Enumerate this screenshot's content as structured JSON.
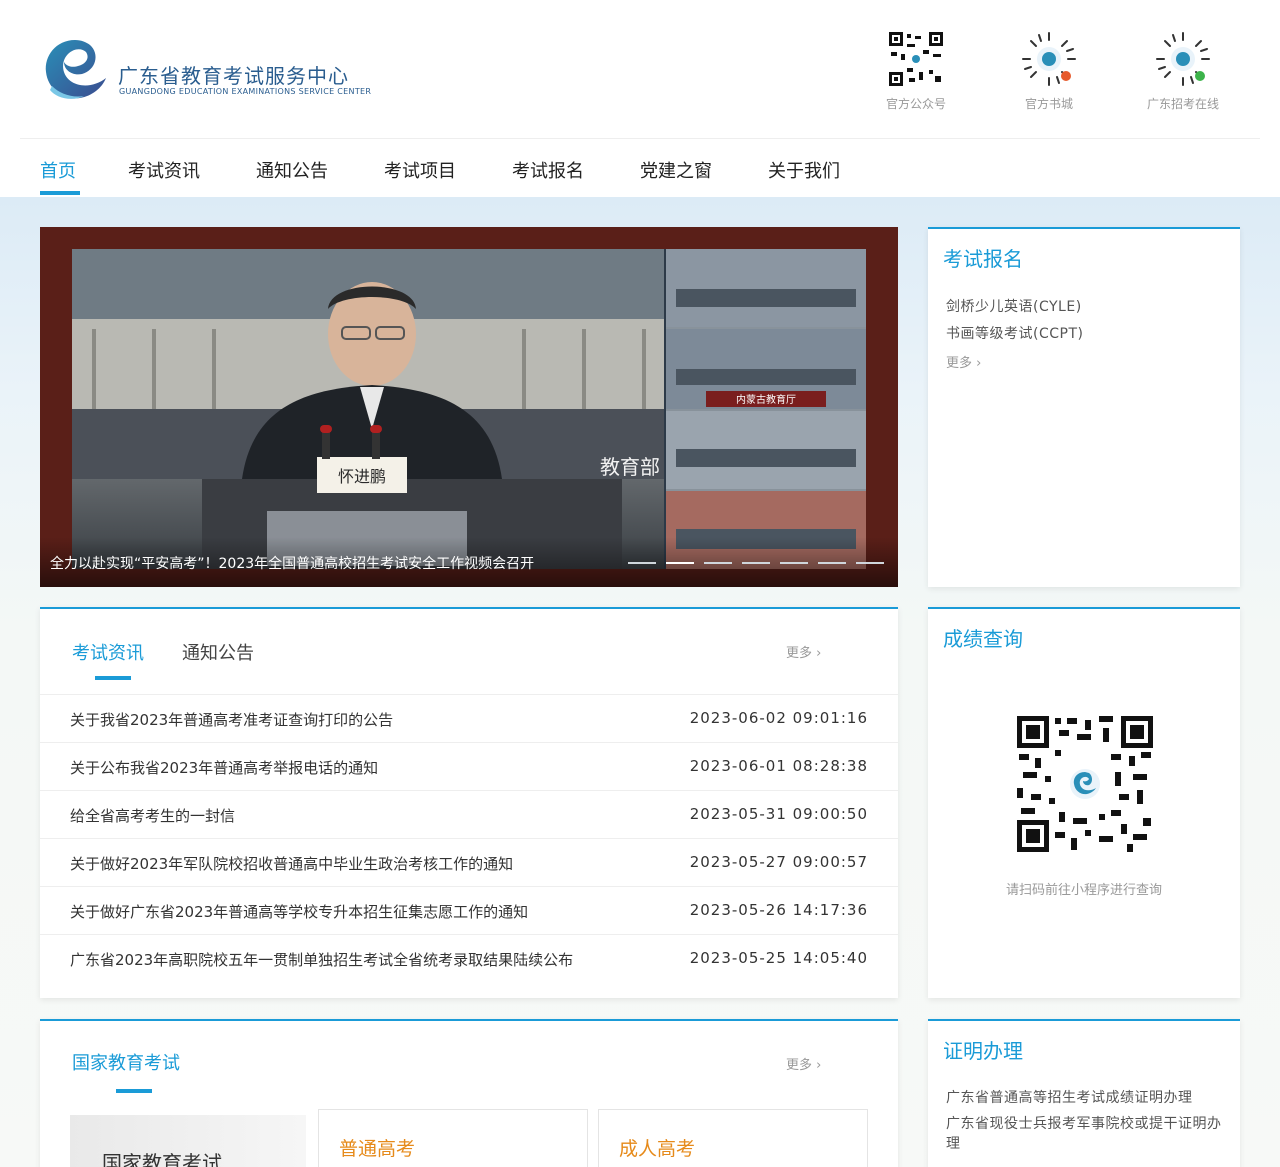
{
  "header": {
    "org_name_cn": "广东省教育考试服务中心",
    "org_name_en": "GUANGDONG EDUCATION EXAMINATIONS SERVICE CENTER",
    "qr_codes": [
      {
        "label": "官方公众号"
      },
      {
        "label": "官方书城"
      },
      {
        "label": "广东招考在线"
      }
    ]
  },
  "nav": {
    "items": [
      "首页",
      "考试资讯",
      "通知公告",
      "考试项目",
      "考试报名",
      "党建之窗",
      "关于我们"
    ],
    "active_index": 0
  },
  "banner": {
    "caption": "全力以赴实现“平安高考”！2023年全国普通高校招生考试安全工作视频会召开",
    "slide_count": 7,
    "active_slide": 1,
    "image_text": {
      "name_card": "怀进鹏",
      "wall_text": "教育部",
      "panel_label": "内蒙古教育厅"
    }
  },
  "exam_registration": {
    "title": "考试报名",
    "items": [
      "剑桥少儿英语(CYLE)",
      "书画等级考试(CCPT)"
    ],
    "more": "更多"
  },
  "news": {
    "tabs": [
      "考试资讯",
      "通知公告"
    ],
    "active_tab": 0,
    "more": "更多",
    "items": [
      {
        "title": "关于我省2023年普通高考准考证查询打印的公告",
        "date": "2023-06-02 09:01:16"
      },
      {
        "title": "关于公布我省2023年普通高考举报电话的通知",
        "date": "2023-06-01 08:28:38"
      },
      {
        "title": "给全省高考考生的一封信",
        "date": "2023-05-31 09:00:50"
      },
      {
        "title": "关于做好2023年军队院校招收普通高中毕业生政治考核工作的通知",
        "date": "2023-05-27 09:00:57"
      },
      {
        "title": "关于做好广东省2023年普通高等学校专升本招生征集志愿工作的通知",
        "date": "2023-05-26 14:17:36"
      },
      {
        "title": "广东省2023年高职院校五年一贯制单独招生考试全省统考录取结果陆续公布",
        "date": "2023-05-25 14:05:40"
      }
    ]
  },
  "score_query": {
    "title": "成绩查询",
    "hint": "请扫码前往小程序进行查询"
  },
  "national_exams": {
    "title": "国家教育考试",
    "more": "更多",
    "image_label": "国家教育考试",
    "cards": [
      "普通高考",
      "成人高考"
    ]
  },
  "certificate": {
    "title": "证明办理",
    "items": [
      "广东省普通高等招生考试成绩证明办理",
      "广东省现役士兵报考军事院校或提干证明办理"
    ]
  },
  "colors": {
    "accent": "#1a9bd7",
    "orange": "#e68a1a",
    "brand_dark": "#2a5d8f"
  }
}
